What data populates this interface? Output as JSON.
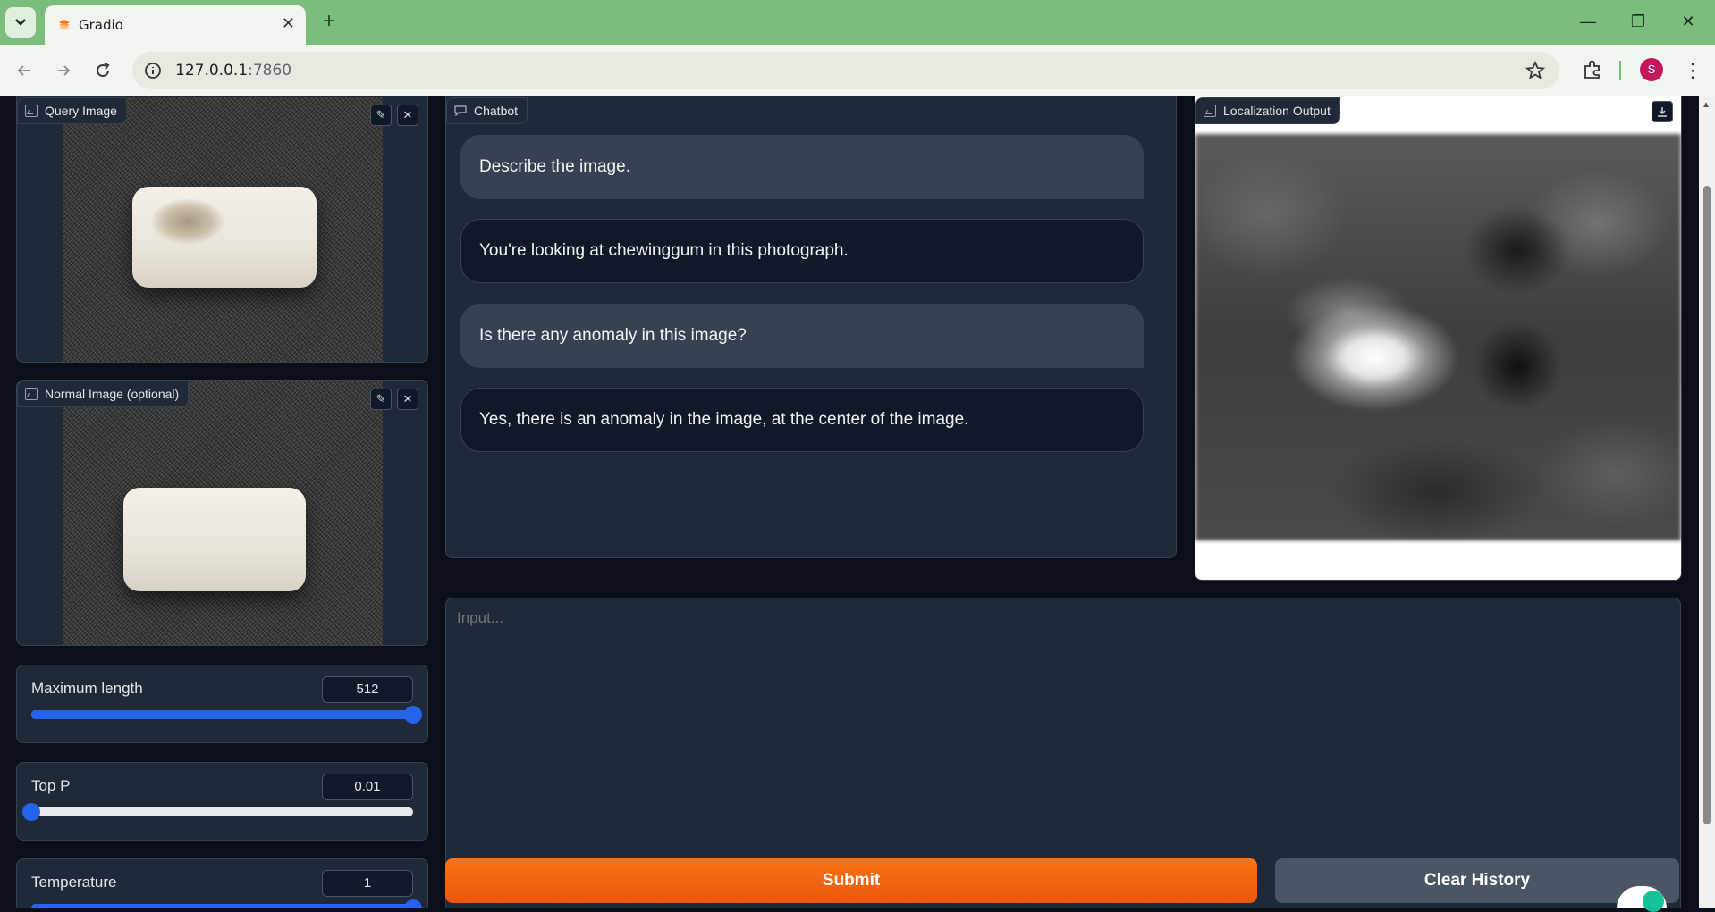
{
  "browser": {
    "tab_title": "Gradio",
    "tab_close": "✕",
    "new_tab": "+",
    "url_host": "127.0.0.1",
    "url_port": ":7860",
    "avatar_letter": "S",
    "window_min": "—",
    "window_restore": "❐",
    "window_close": "✕"
  },
  "query_image": {
    "label": "Query Image"
  },
  "normal_image": {
    "label": "Normal Image (optional)"
  },
  "chatbot": {
    "label": "Chatbot",
    "messages": [
      {
        "role": "user",
        "text": "Describe the image."
      },
      {
        "role": "bot",
        "text": "You're looking at chewinggum in this photograph."
      },
      {
        "role": "user",
        "text": "Is there any anomaly in this image?"
      },
      {
        "role": "bot",
        "text": "Yes, there is an anomaly in the image, at the center of the image."
      }
    ]
  },
  "localization": {
    "label": "Localization Output"
  },
  "sliders": {
    "max_length": {
      "label": "Maximum length",
      "value": "512",
      "fraction": 1.0
    },
    "top_p": {
      "label": "Top P",
      "value": "0.01",
      "fraction": 0.0
    },
    "temperature": {
      "label": "Temperature",
      "value": "1",
      "fraction": 1.0
    }
  },
  "input": {
    "placeholder": "Input..."
  },
  "buttons": {
    "submit": "Submit",
    "clear": "Clear History"
  },
  "colors": {
    "accent": "#f97316",
    "slider": "#2563eb",
    "panel": "#1f2937",
    "background": "#0b0f19"
  }
}
